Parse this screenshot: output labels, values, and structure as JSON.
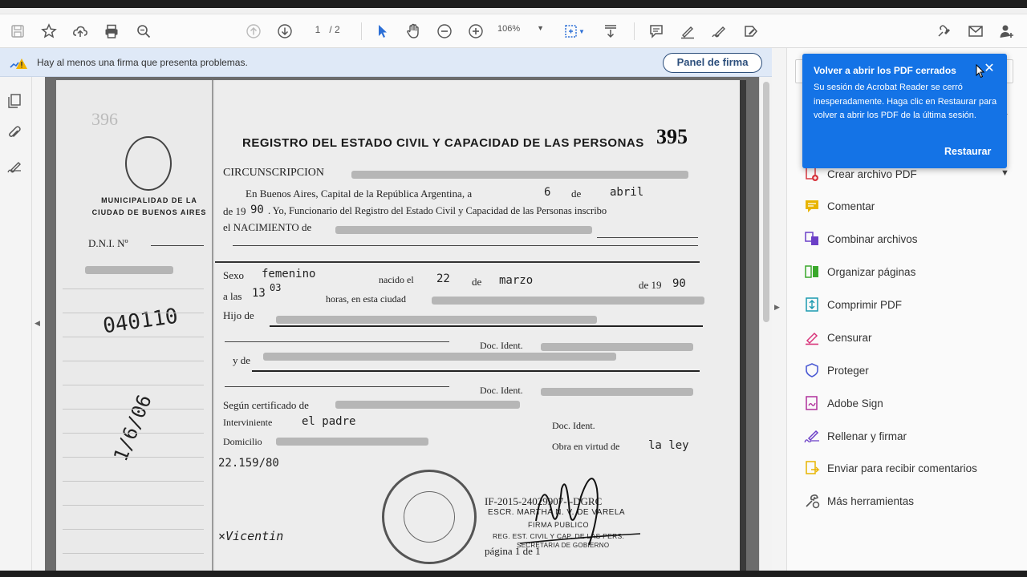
{
  "toolbar": {
    "page_current": "1",
    "page_total": "/ 2",
    "zoom": "106%"
  },
  "signature_bar": {
    "message": "Hay al menos una firma que presenta problemas.",
    "button_label": "Panel de firma"
  },
  "document": {
    "number": "395",
    "stamp_number": "396",
    "title": "REGISTRO DEL ESTADO CIVIL Y CAPACIDAD DE LAS PERSONAS",
    "municipality": "MUNICIPALIDAD DE LA CIUDAD DE BUENOS AIRES",
    "dni_label": "D.N.I. Nº",
    "left_handwritten_1": "040110",
    "left_handwritten_2": "1/6/06",
    "circunscripcion": "CIRCUNSCRIPCION",
    "line1_a": "En Buenos Aires, Capital de la República Argentina, a",
    "line1_day": "6",
    "line1_de": "de",
    "line1_month": "abril",
    "line2_a": "de 19",
    "line2_year": "90",
    "line2_b": ". Yo, Funcionario del Registro del Estado Civil y Capacidad de las Personas inscribo",
    "line3": "el NACIMIENTO de",
    "sexo_label": "Sexo",
    "sexo_value": "femenino",
    "nacido_label": "nacido el",
    "nacido_day": "22",
    "nacido_de": "de",
    "nacido_month": "marzo",
    "nacido_year_label": "de 19",
    "nacido_year": "90",
    "hora_label": "a las",
    "hora_value": "13",
    "hora_min": "03",
    "hora_rest": "horas, en esta ciudad",
    "hijo_label": "Hijo de",
    "doc_ident_1": "Doc. Ident.",
    "y_de_label": "y de",
    "doc_ident_2": "Doc. Ident.",
    "segun_label": "Según certificado de",
    "interviniente_label": "Interviniente",
    "interviniente_value": "el padre",
    "doc_ident_3": "Doc. Ident.",
    "domicilio_label": "Domicilio",
    "obra_label": "Obra en virtud de",
    "obra_value": "la ley",
    "ley_number": "22.159/80",
    "if_line": "IF-2015-24029907-   -DGRC",
    "escr_line": "ESCR. MARTHA N. V. DE VARELA",
    "firma_line": "FIRMA PUBLICO",
    "reg_line": "REG. EST. CIVIL Y CAP. DE LAS PERS.",
    "secretaria_line": "SECRETARIA DE GOBIERNO",
    "pagina_line": "página 1 de 1",
    "signature_left": "×Vicentin"
  },
  "tools": [
    {
      "label": "Crear archivo PDF",
      "color": "#d7373f"
    },
    {
      "label": "Comentar",
      "color": "#e8b400"
    },
    {
      "label": "Combinar archivos",
      "color": "#6b3fc7"
    },
    {
      "label": "Organizar páginas",
      "color": "#39a82a"
    },
    {
      "label": "Comprimir PDF",
      "color": "#1b9ab0"
    },
    {
      "label": "Censurar",
      "color": "#d8347a"
    },
    {
      "label": "Proteger",
      "color": "#4c5bd4"
    },
    {
      "label": "Adobe Sign",
      "color": "#b0309b"
    },
    {
      "label": "Rellenar y firmar",
      "color": "#6b3fc7"
    },
    {
      "label": "Enviar para recibir comentarios",
      "color": "#e8b400"
    },
    {
      "label": "Más herramientas",
      "color": "#555555"
    }
  ],
  "popup": {
    "title": "Volver a abrir los PDF cerrados",
    "body": "Su sesión de Acrobat Reader se cerró inesperadamente. Haga clic en Restaurar para volver a abrir los PDF de la última sesión.",
    "action": "Restaurar"
  }
}
